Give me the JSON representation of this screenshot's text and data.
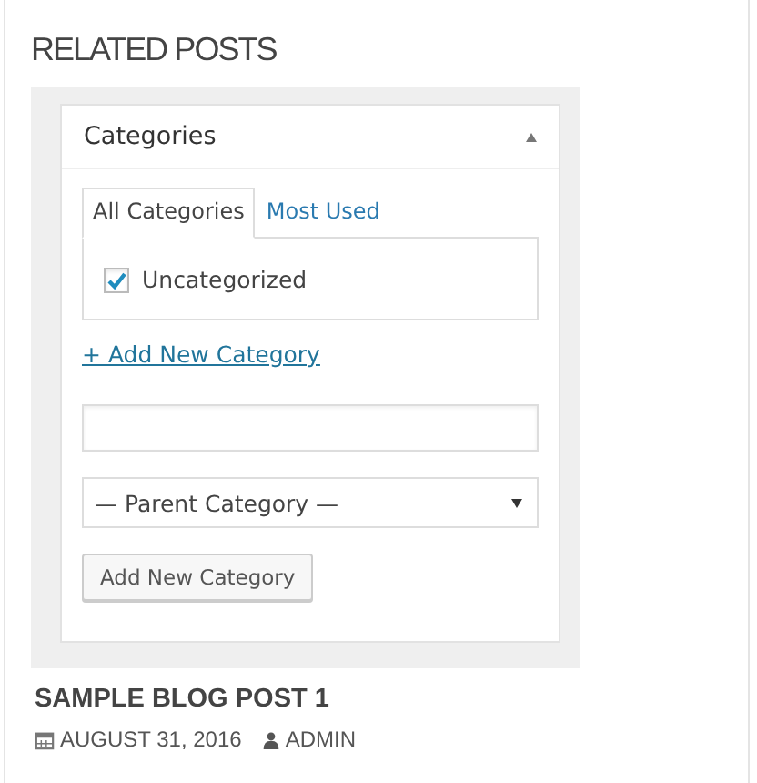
{
  "section_title": "RELATED POSTS",
  "panel": {
    "title": "Categories",
    "expanded": true,
    "tabs": [
      {
        "label": "All Categories",
        "selected": true
      },
      {
        "label": "Most Used",
        "selected": false
      }
    ],
    "categories": [
      {
        "label": "Uncategorized",
        "checked": true
      }
    ],
    "add_link": "+ Add New Category",
    "parent_select": {
      "value": "— Parent Category —"
    },
    "add_button": "Add New Category"
  },
  "post": {
    "title": "SAMPLE BLOG POST 1",
    "date": "AUGUST 31, 2016",
    "author": "ADMIN"
  }
}
